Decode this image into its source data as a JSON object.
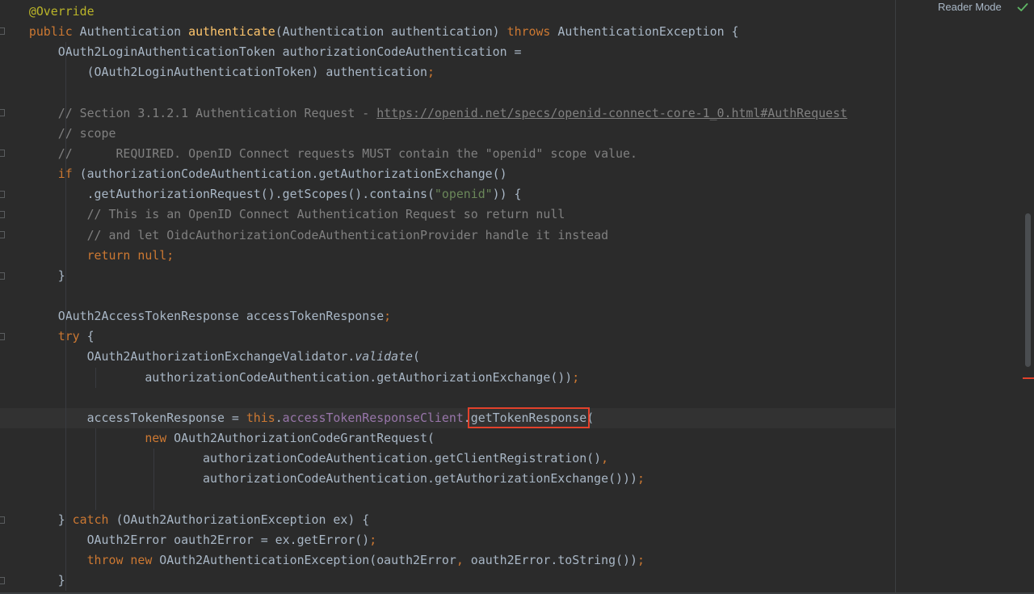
{
  "editor": {
    "reader_mode_label": "Reader Mode",
    "inspection_icon": "green-check-icon",
    "colors": {
      "background": "#2b2b2b",
      "keyword": "#cc7832",
      "annotation": "#bbb529",
      "method_decl": "#ffc66d",
      "string": "#6a8759",
      "comment": "#808080",
      "field": "#9876aa",
      "default_text": "#a9b7c6",
      "highlight_box": "#e2412b"
    }
  },
  "code": {
    "l1": {
      "ann": "@Override"
    },
    "l2": {
      "kw_public": "public",
      "t1": " Authentication ",
      "fn": "authenticate",
      "t2": "(Authentication authentication) ",
      "kw_throws": "throws",
      "t3": " AuthenticationException {"
    },
    "l3": {
      "t1": "OAuth2LoginAuthenticationToken authorizationCodeAuthentication ="
    },
    "l4": {
      "t1": "(OAuth2LoginAuthenticationToken) authentication",
      "semi": ";"
    },
    "l5": {},
    "l6": {
      "cmt": "// Section 3.1.2.1 Authentication Request - ",
      "link": "https://openid.net/specs/openid-connect-core-1_0.html#AuthRequest"
    },
    "l7": {
      "cmt": "// scope"
    },
    "l8": {
      "cmt": "//      REQUIRED. OpenID Connect requests MUST contain the \"openid\" scope value."
    },
    "l9": {
      "kw_if": "if",
      "t1": " (authorizationCodeAuthentication.getAuthorizationExchange()"
    },
    "l10": {
      "t1": ".getAuthorizationRequest().getScopes().contains(",
      "str": "\"openid\"",
      "t2": ")) {"
    },
    "l11": {
      "cmt": "// This is an OpenID Connect Authentication Request so return null"
    },
    "l12": {
      "cmt": "// and let OidcAuthorizationCodeAuthenticationProvider handle it instead"
    },
    "l13": {
      "kw_return": "return",
      "sp": " ",
      "kw_null": "null",
      "semi": ";"
    },
    "l14": {
      "t1": "}"
    },
    "l15": {},
    "l16": {
      "t1": "OAuth2AccessTokenResponse accessTokenResponse",
      "semi": ";"
    },
    "l17": {
      "kw_try": "try",
      "t1": " {"
    },
    "l18": {
      "t1": "OAuth2AuthorizationExchangeValidator.",
      "it": "validate",
      "t2": "("
    },
    "l19": {
      "t1": "authorizationCodeAuthentication.getAuthorizationExchange())",
      "semi": ";"
    },
    "l20": {},
    "l21": {
      "t1": "accessTokenResponse = ",
      "kw_this": "this",
      "dot": ".",
      "field": "accessTokenResponseClient",
      "dot2": ".",
      "hl": "getTokenResponse",
      "t2": "("
    },
    "l22": {
      "kw_new": "new",
      "t1": " OAuth2AuthorizationCodeGrantRequest("
    },
    "l23": {
      "t1": "authorizationCodeAuthentication.getClientRegistration()",
      "comma": ","
    },
    "l24": {
      "t1": "authorizationCodeAuthentication.getAuthorizationExchange()))",
      "semi": ";"
    },
    "l25": {},
    "l26": {
      "t1": "} ",
      "kw_catch": "catch",
      "t2": " (OAuth2AuthorizationException ex) {"
    },
    "l27": {
      "t1": "OAuth2Error oauth2Error = ex.getError()",
      "semi": ";"
    },
    "l28": {
      "kw_throw": "throw",
      "sp": " ",
      "kw_new": "new",
      "t1": " OAuth2AuthenticationException(oauth2Error",
      "comma": ",",
      "t2": " oauth2Error.toString())",
      "semi": ";"
    },
    "l29": {
      "t1": "}"
    }
  }
}
